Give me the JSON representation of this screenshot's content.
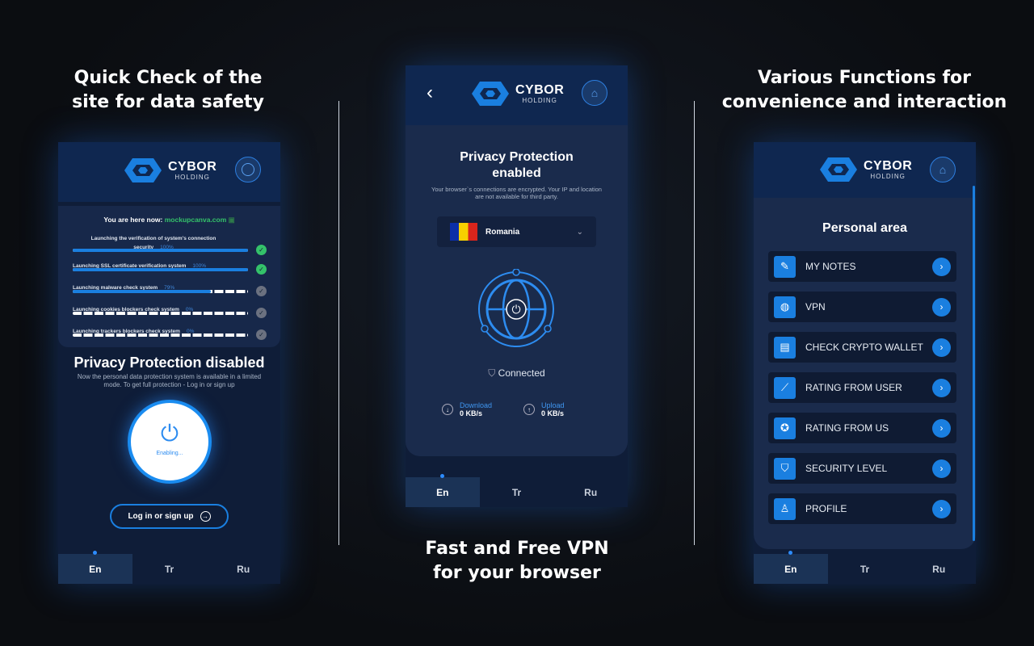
{
  "captions": {
    "left": [
      "Quick Check of the",
      "site for data safety"
    ],
    "center": [
      "Fast and Free VPN",
      "for your browser"
    ],
    "right": [
      "Various Functions for",
      "convenience and interaction"
    ]
  },
  "brand": {
    "name": "CYBOR",
    "sub": "HOLDING",
    "accent": "#1a7fe0"
  },
  "left": {
    "here_label": "You are here now:",
    "site": "mockupcanva.com",
    "checks": [
      {
        "label": "Launching the verification of system's connection security",
        "pct": "100%",
        "progress": 100,
        "done": true
      },
      {
        "label": "Launching SSL certificate verification system",
        "pct": "100%",
        "progress": 100,
        "done": true
      },
      {
        "label": "Launching malware check system",
        "pct": "79%",
        "progress": 79,
        "done": false
      },
      {
        "label": "Launching cookies blockers check system",
        "pct": "0%",
        "progress": 0,
        "done": false
      },
      {
        "label": "Launching trackers blockers check system",
        "pct": "0%",
        "progress": 0,
        "done": false
      }
    ],
    "title": "Privacy Protection disabled",
    "desc": "Now the personal data protection system is available in a limited mode. To get full protection - Log in or sign up",
    "power_status": "Enabling...",
    "login": "Log in or sign up"
  },
  "center": {
    "title": "Privacy Protection enabled",
    "desc": "Your browser`s connections are encrypted. Your IP and location are not available for third party.",
    "country": "Romania",
    "status": "Connected",
    "download_label": "Download",
    "download_value": "0 KB/s",
    "upload_label": "Upload",
    "upload_value": "0 KB/s"
  },
  "right": {
    "title": "Personal area",
    "items": [
      "MY NOTES",
      "VPN",
      "CHECK CRYPTO WALLET",
      "RATING FROM USER",
      "RATING FROM US",
      "SECURITY LEVEL",
      "PROFILE"
    ],
    "icons": [
      "notes-icon",
      "globe-icon",
      "wallet-icon",
      "chart-icon",
      "award-icon",
      "shield-icon",
      "profile-icon"
    ]
  },
  "tabs": [
    "En",
    "Tr",
    "Ru"
  ]
}
